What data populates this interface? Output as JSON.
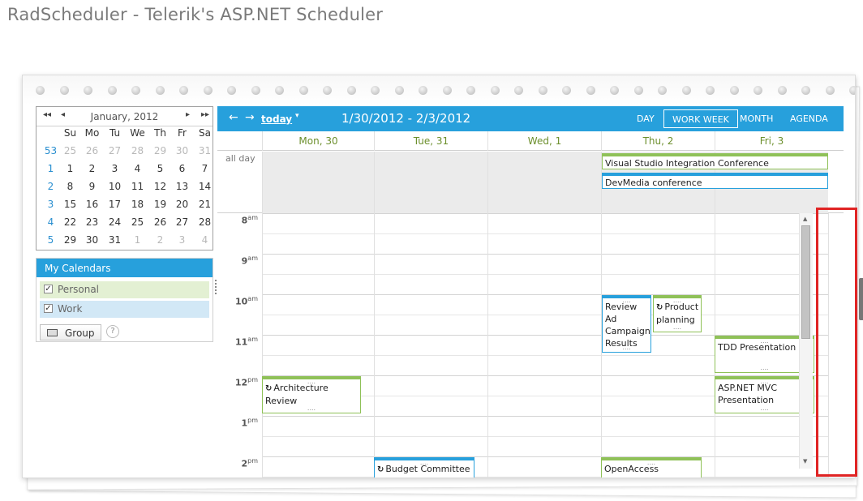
{
  "page": {
    "title": "RadScheduler - Telerik's ASP.NET Scheduler"
  },
  "mini_calendar": {
    "title": "January, 2012",
    "nav": {
      "first": "◂◂",
      "prev": "◂",
      "next": "▸",
      "last": "▸▸"
    },
    "weekday_headers": [
      "Su",
      "Mo",
      "Tu",
      "We",
      "Th",
      "Fr",
      "Sa"
    ],
    "weeks": [
      {
        "week": "53",
        "days": [
          "25",
          "26",
          "27",
          "28",
          "29",
          "30",
          "31"
        ],
        "dim": [
          true,
          true,
          true,
          true,
          true,
          true,
          true
        ]
      },
      {
        "week": "1",
        "days": [
          "1",
          "2",
          "3",
          "4",
          "5",
          "6",
          "7"
        ],
        "dim": [
          false,
          false,
          false,
          false,
          false,
          false,
          false
        ]
      },
      {
        "week": "2",
        "days": [
          "8",
          "9",
          "10",
          "11",
          "12",
          "13",
          "14"
        ],
        "dim": [
          false,
          false,
          false,
          false,
          false,
          false,
          false
        ]
      },
      {
        "week": "3",
        "days": [
          "15",
          "16",
          "17",
          "18",
          "19",
          "20",
          "21"
        ],
        "dim": [
          false,
          false,
          false,
          false,
          false,
          false,
          false
        ]
      },
      {
        "week": "4",
        "days": [
          "22",
          "23",
          "24",
          "25",
          "26",
          "27",
          "28"
        ],
        "dim": [
          false,
          false,
          false,
          false,
          false,
          false,
          false
        ]
      },
      {
        "week": "5",
        "days": [
          "29",
          "30",
          "31",
          "1",
          "2",
          "3",
          "4"
        ],
        "dim": [
          false,
          false,
          false,
          true,
          true,
          true,
          true
        ]
      }
    ]
  },
  "my_calendars": {
    "header": "My Calendars",
    "items": [
      {
        "label": "Personal",
        "checked": "✓",
        "color": "#e3f0d3"
      },
      {
        "label": "Work",
        "checked": "✓",
        "color": "#d2e8f6"
      }
    ],
    "group_button": "Group",
    "help": "?"
  },
  "toolbar": {
    "prev": "←",
    "next": "→",
    "today": "today",
    "today_caret": "▾",
    "date_range": "1/30/2012 - 2/3/2012",
    "views": [
      {
        "label": "DAY",
        "selected": false
      },
      {
        "label": "WORK WEEK",
        "selected": true
      },
      {
        "label": "MONTH",
        "selected": false
      },
      {
        "label": "AGENDA",
        "selected": false
      }
    ]
  },
  "day_headers": [
    "Mon, 30",
    "Tue, 31",
    "Wed, 1",
    "Thu, 2",
    "Fri, 3"
  ],
  "allday_label": "all day",
  "allday_events": [
    {
      "title": "Visual Studio Integration Conference",
      "calendar": "personal"
    },
    {
      "title": "DevMedia conference",
      "calendar": "work"
    }
  ],
  "time_labels": [
    {
      "hour": "8",
      "suffix": "am"
    },
    {
      "hour": "9",
      "suffix": "am"
    },
    {
      "hour": "10",
      "suffix": "am"
    },
    {
      "hour": "11",
      "suffix": "am"
    },
    {
      "hour": "12",
      "suffix": "pm"
    },
    {
      "hour": "1",
      "suffix": "pm"
    },
    {
      "hour": "2",
      "suffix": "pm"
    }
  ],
  "appointments": [
    {
      "title": "Review Ad Campaign Results",
      "calendar": "work",
      "recurring": false,
      "day": 3
    },
    {
      "title": "Product planning",
      "calendar": "personal",
      "recurring": true,
      "day": 3
    },
    {
      "title": "TDD Presentation",
      "calendar": "personal",
      "recurring": false,
      "day": 4
    },
    {
      "title": "Architecture Review",
      "calendar": "personal",
      "recurring": true,
      "day": 0
    },
    {
      "title": "ASP.NET MVC Presentation",
      "calendar": "personal",
      "recurring": false,
      "day": 4
    },
    {
      "title": "Budget Committee",
      "calendar": "work",
      "recurring": true,
      "day": 1
    },
    {
      "title": "OpenAccess",
      "calendar": "personal",
      "recurring": false,
      "day": 3
    }
  ],
  "icons": {
    "recurrence": "recurrence-icon",
    "group": "group-icon",
    "help": "help-icon",
    "scroll_up": "scroll-up-arrow-icon",
    "scroll_down": "scroll-down-arrow-icon"
  },
  "colors": {
    "accent": "#27a0dc",
    "personal": "#8fc158",
    "work": "#27a0dc",
    "highlight": "#e02424",
    "day_header_text": "#6c8f2c"
  }
}
